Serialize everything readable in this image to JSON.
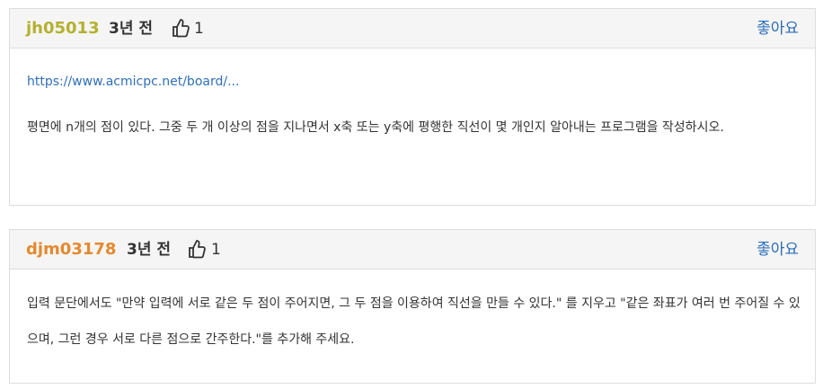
{
  "comments": [
    {
      "username": "jh05013",
      "username_color": "#b5b02f",
      "time": "3년 전",
      "like_count": "1",
      "like_label": "좋아요",
      "link": "https://www.acmicpc.net/board/...",
      "text": "평면에 n개의 점이 있다. 그중 두 개 이상의 점을 지나면서 x축 또는 y축에 평행한 직선이 몇 개인지 알아내는 프로그램을 작성하시오."
    },
    {
      "username": "djm03178",
      "username_color": "#e4892f",
      "time": "3년 전",
      "like_count": "1",
      "like_label": "좋아요",
      "text": "입력 문단에서도 \"만약 입력에 서로 같은 두 점이 주어지면, 그 두 점을 이용하여 직선을 만들 수 있다.\" 를 지우고 \"같은 좌표가 여러 번 주어질 수 있으며, 그런 경우 서로 다른 점으로 간주한다.\"를 추가해 주세요."
    }
  ]
}
